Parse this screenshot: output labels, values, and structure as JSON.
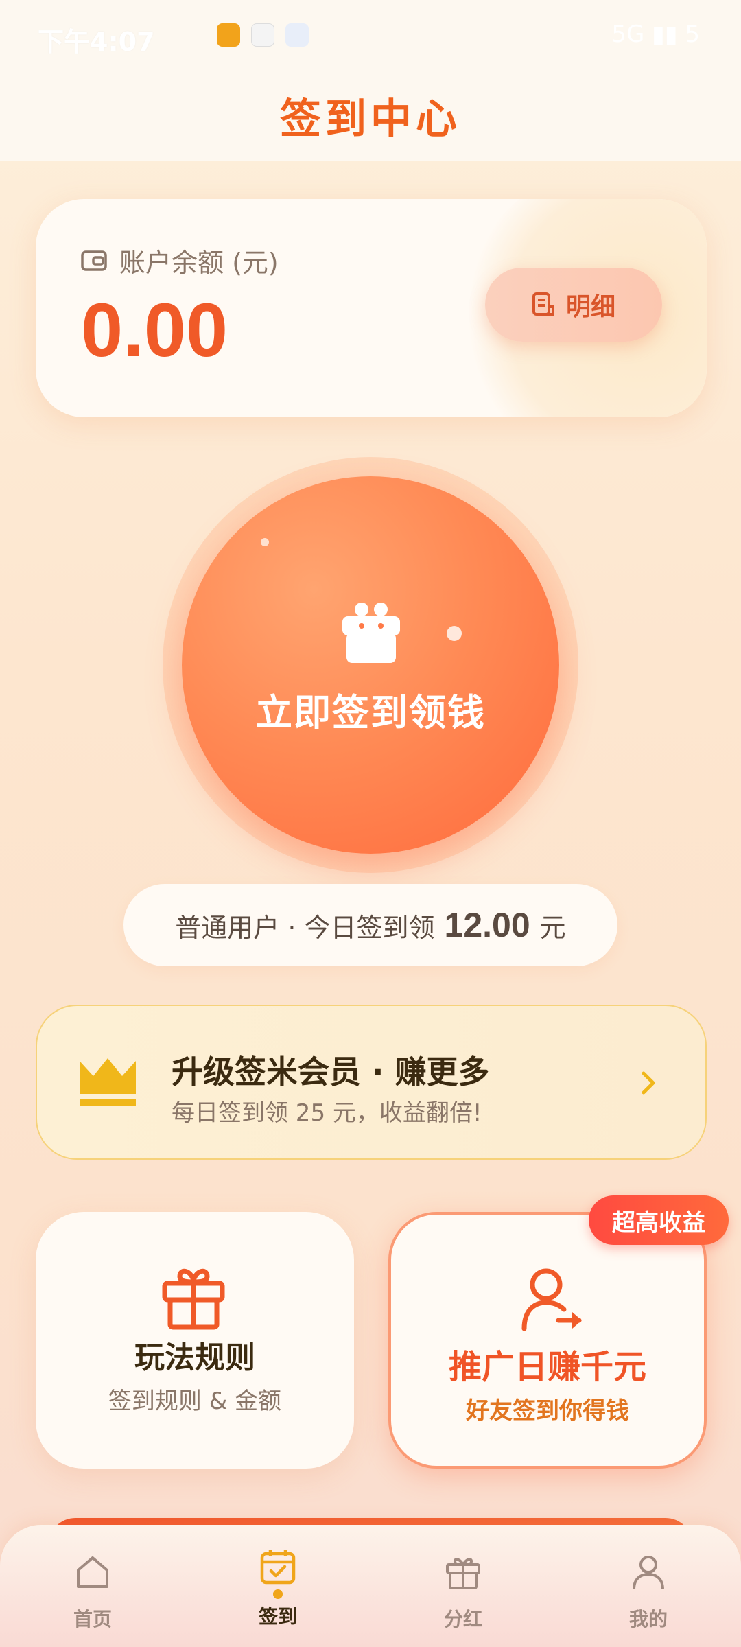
{
  "status_bar": {
    "time": "下午4:07",
    "right": "5G ▮▮ 5"
  },
  "header": {
    "title": "签到中心"
  },
  "balance": {
    "label": "账户余额 (元)",
    "value": "0.00",
    "detail_label": "明细"
  },
  "sign": {
    "button_label": "立即签到领钱"
  },
  "reward": {
    "prefix": "普通用户 · 今日签到领",
    "amount": "12.00",
    "unit": "元"
  },
  "vip": {
    "title": "升级签米会员 · 赚更多",
    "subtitle": "每日签到领 25 元，收益翻倍!"
  },
  "cards": {
    "rules": {
      "title": "玩法规则",
      "subtitle": "签到规则 & 金额"
    },
    "promo": {
      "title": "推广日赚千元",
      "subtitle": "好友签到你得钱",
      "badge": "超高收益"
    }
  },
  "nav": {
    "items": [
      {
        "label": "首页",
        "icon": "home-icon"
      },
      {
        "label": "签到",
        "icon": "calendar-check-icon"
      },
      {
        "label": "分红",
        "icon": "gift-icon"
      },
      {
        "label": "我的",
        "icon": "user-icon"
      }
    ],
    "active_index": 1
  },
  "colors": {
    "accent": "#f05a28",
    "gold": "#f0b71a",
    "background": "#fde6cf"
  }
}
